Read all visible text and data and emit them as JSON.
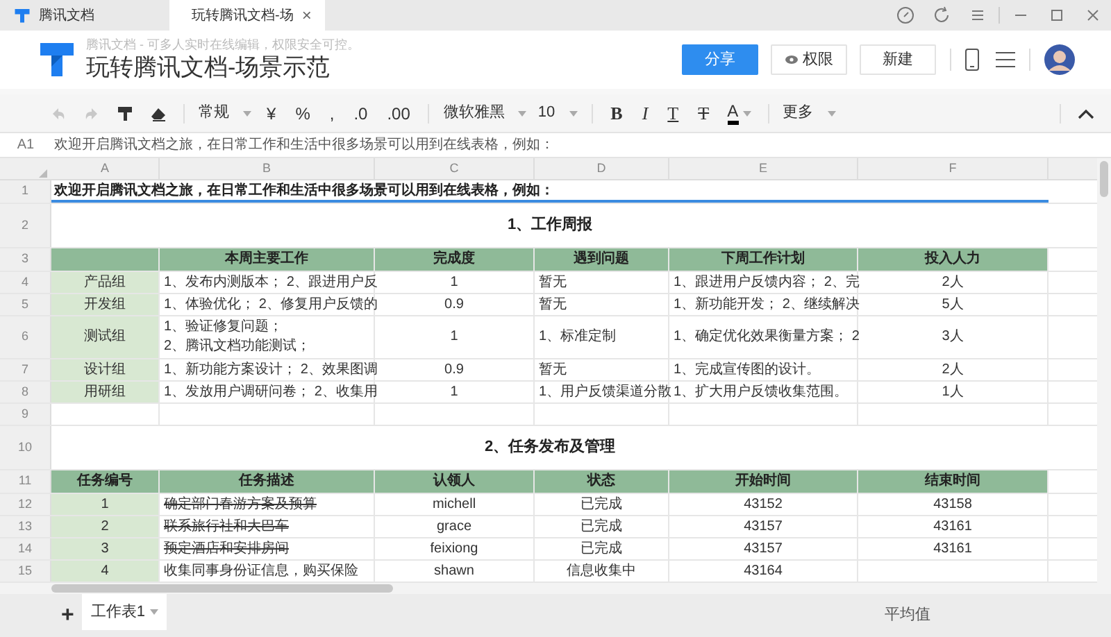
{
  "browser_tabs": [
    {
      "label": "腾讯文档",
      "kind": "logo",
      "selected": false
    },
    {
      "label": "玩转腾讯文档-场",
      "kind": "sheet",
      "selected": true,
      "close": "×"
    }
  ],
  "header": {
    "subtitle": "腾讯文档 - 可多人实时在线编辑，权限安全可控。",
    "title": "玩转腾讯文档-场景示范",
    "buttons": [
      {
        "label": "分享",
        "kind": "primary"
      },
      {
        "label": "权限",
        "kind": "eye"
      },
      {
        "label": "新建",
        "kind": "plain"
      }
    ]
  },
  "toolbar": {
    "number_format": "常规",
    "currency": "¥",
    "percent": "%",
    "comma": ",",
    "decrease_decimal": ".0",
    "increase_decimal": ".00",
    "font": "微软雅黑",
    "size": "10",
    "bold": "B",
    "italic": "I",
    "underline": "T",
    "strike": "T",
    "font_color_letter": "A",
    "more": "更多"
  },
  "formula_bar": {
    "cell": "A1",
    "content": "欢迎开启腾讯文档之旅，在日常工作和生活中很多场景可以用到在线表格，例如："
  },
  "columns": [
    "A",
    "B",
    "C",
    "D",
    "E",
    "F"
  ],
  "rows": [
    {
      "number": "1",
      "kind": "text",
      "cells": [
        "欢迎开启腾讯文档之旅，在日常工作和生活中很多场景可以用到在线表格，例如："
      ]
    },
    {
      "number": "2",
      "kind": "title",
      "cells": [
        "1、工作周报"
      ]
    },
    {
      "number": "3",
      "kind": "header",
      "cells": [
        "",
        "本周主要工作",
        "完成度",
        "遇到问题",
        "下周工作计划",
        "投入人力"
      ]
    },
    {
      "number": "4",
      "kind": "data",
      "cells": [
        "产品组",
        "1、发布内测版本； 2、跟进用户反",
        "1",
        "暂无",
        "1、跟进用户反馈内容； 2、完",
        "2人"
      ]
    },
    {
      "number": "5",
      "kind": "data",
      "cells": [
        "开发组",
        "1、体验优化； 2、修复用户反馈的",
        "0.9",
        "暂无",
        "1、新功能开发； 2、继续解决",
        "5人"
      ]
    },
    {
      "number": "6",
      "kind": "data",
      "cells": [
        "测试组",
        "1、验证修复问题；\n2、腾讯文档功能测试；",
        "1",
        "1、标准定制",
        "1、确定优化效果衡量方案； 2",
        "3人"
      ]
    },
    {
      "number": "7",
      "kind": "data",
      "cells": [
        "设计组",
        "1、新功能方案设计； 2、效果图调",
        "0.9",
        "暂无",
        "1、完成宣传图的设计。",
        "2人"
      ]
    },
    {
      "number": "8",
      "kind": "data",
      "cells": [
        "用研组",
        "1、发放用户调研问卷； 2、收集用",
        "1",
        "1、用户反馈渠道分散",
        "1、扩大用户反馈收集范围。",
        "1人"
      ]
    },
    {
      "number": "9",
      "kind": "blank",
      "cells": []
    },
    {
      "number": "10",
      "kind": "title",
      "cells": [
        "2、任务发布及管理"
      ]
    },
    {
      "number": "11",
      "kind": "header",
      "cells": [
        "任务编号",
        "任务描述",
        "认领人",
        "状态",
        "开始时间",
        "结束时间"
      ]
    },
    {
      "number": "12",
      "kind": "task",
      "done": true,
      "cells": [
        "1",
        "确定部门春游方案及预算",
        "michell",
        "已完成",
        "43152",
        "43158"
      ]
    },
    {
      "number": "13",
      "kind": "task",
      "done": true,
      "cells": [
        "2",
        "联系旅行社和大巴车",
        "grace",
        "已完成",
        "43157",
        "43161"
      ]
    },
    {
      "number": "14",
      "kind": "task",
      "done": true,
      "cells": [
        "3",
        "预定酒店和安排房间",
        "feixiong",
        "已完成",
        "43157",
        "43161"
      ]
    },
    {
      "number": "15",
      "kind": "task",
      "done": false,
      "cells": [
        "4",
        "收集同事身份证信息，购买保险",
        "shawn",
        "信息收集中",
        "43164"
      ]
    }
  ],
  "sheet_tabs": [
    {
      "label": "工作表1",
      "selected": true
    }
  ],
  "add_sheet": "+",
  "status": "平均值"
}
